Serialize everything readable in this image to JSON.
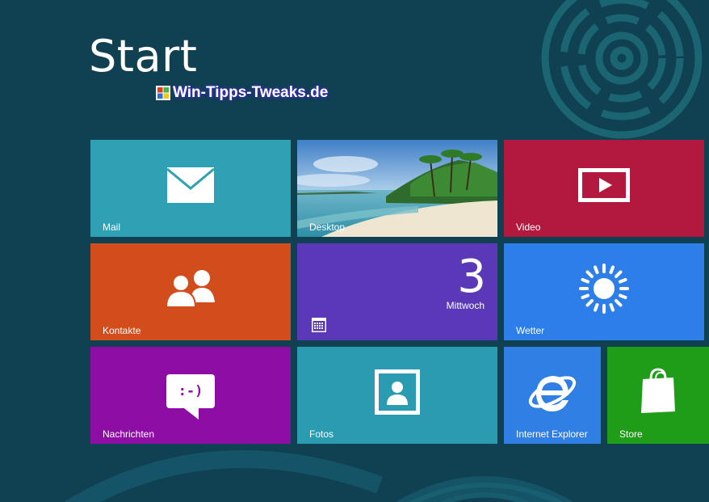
{
  "page": {
    "title": "Start"
  },
  "watermark": {
    "text": "Win-Tipps-Tweaks.de"
  },
  "tiles": {
    "mail": {
      "label": "Mail",
      "color": "#2ea1b4",
      "icon": "mail-icon"
    },
    "desktop": {
      "label": "Desktop",
      "icon": "beach-wallpaper"
    },
    "video": {
      "label": "Video",
      "color": "#b3193e",
      "icon": "play-icon"
    },
    "kontakte": {
      "label": "Kontakte",
      "color": "#d24c1c",
      "icon": "people-icon"
    },
    "kalender": {
      "date": "3",
      "weekday": "Mittwoch",
      "color": "#5a38b8",
      "icon": "calendar-icon"
    },
    "wetter": {
      "label": "Wetter",
      "color": "#2d7ee8",
      "icon": "sun-icon"
    },
    "nachrichten": {
      "label": "Nachrichten",
      "color": "#8e0ea5",
      "icon": "chat-bubble-icon",
      "emoticon": ":-)"
    },
    "fotos": {
      "label": "Fotos",
      "color": "#2a9bb0",
      "icon": "photo-icon"
    },
    "ie": {
      "label": "Internet Explorer",
      "color": "#2f7fe4",
      "icon": "internet-explorer-icon"
    },
    "store": {
      "label": "Store",
      "color": "#1f9c18",
      "icon": "shopping-bag-icon"
    }
  }
}
